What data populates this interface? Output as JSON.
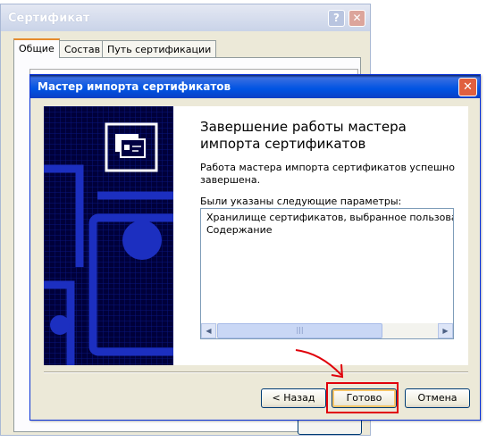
{
  "background_window": {
    "title": "Сертификат",
    "help_glyph": "?",
    "close_glyph": "✕",
    "tabs": [
      {
        "label": "Общие"
      },
      {
        "label": "Состав"
      },
      {
        "label": "Путь сертификации"
      }
    ]
  },
  "wizard": {
    "title": "Мастер импорта сертификатов",
    "close_glyph": "✕",
    "heading": "Завершение работы мастера импорта сертификатов",
    "success_text": "Работа мастера импорта сертификатов успешно завершена.",
    "params_label": "Были указаны следующие параметры:",
    "params": [
      "Хранилище сертификатов, выбранное пользователем",
      "Содержание"
    ],
    "scroll_left_glyph": "◀",
    "scroll_right_glyph": "▶",
    "scroll_grip_glyph": "|||",
    "buttons": {
      "back": "< Назад",
      "finish": "Готово",
      "cancel": "Отмена"
    }
  },
  "colors": {
    "titlebar_active": "#0054e3",
    "wizard_panel": "#000042",
    "annotation": "#e0000a"
  },
  "icons": [
    "certificate-icon",
    "close-icon",
    "help-icon",
    "arrow-annotation-icon"
  ]
}
